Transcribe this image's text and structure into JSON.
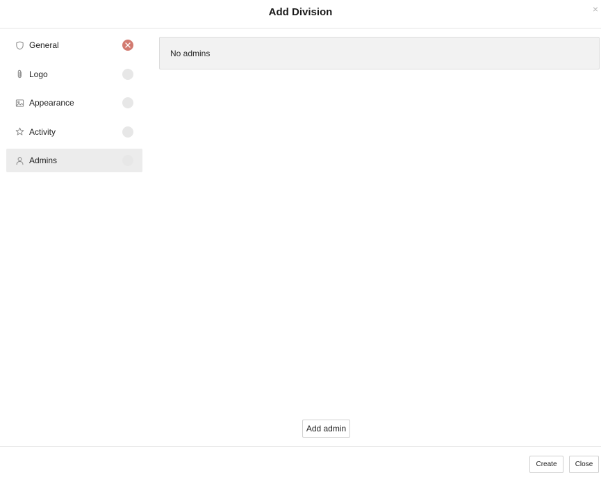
{
  "header": {
    "title": "Add Division",
    "close_glyph": "×"
  },
  "sidebar": {
    "items": [
      {
        "label": "General",
        "icon": "shield-icon",
        "status": "error"
      },
      {
        "label": "Logo",
        "icon": "paperclip-icon",
        "status": "empty"
      },
      {
        "label": "Appearance",
        "icon": "image-icon",
        "status": "empty"
      },
      {
        "label": "Activity",
        "icon": "star-icon",
        "status": "empty"
      },
      {
        "label": "Admins",
        "icon": "user-icon",
        "status": "empty",
        "active": true
      }
    ]
  },
  "main": {
    "empty_message": "No admins",
    "add_button_label": "Add admin"
  },
  "footer": {
    "create_label": "Create",
    "close_label": "Close"
  },
  "colors": {
    "error_status": "#d27a70",
    "empty_status": "#e7e7e7",
    "active_item_bg": "#ececec"
  }
}
